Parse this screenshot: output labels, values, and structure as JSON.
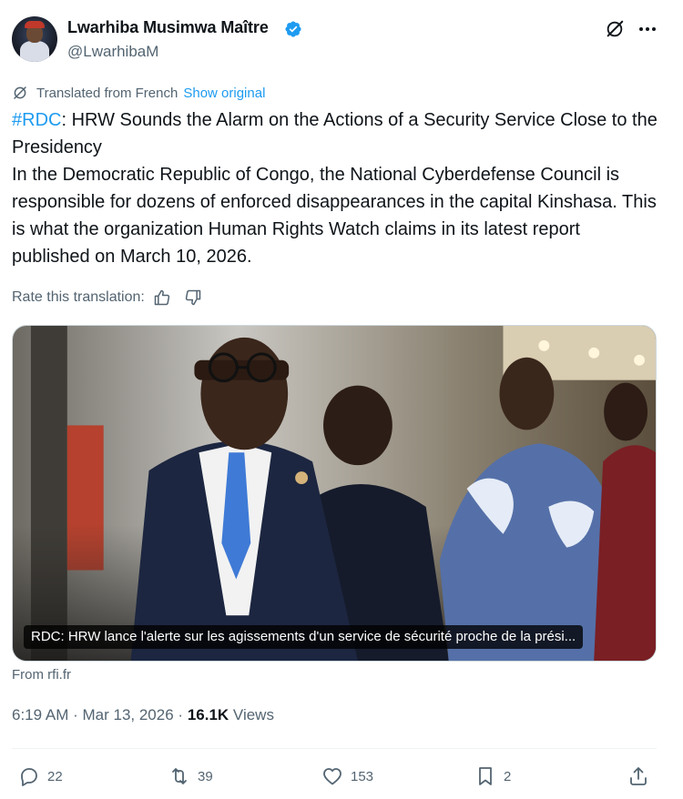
{
  "author": {
    "display_name": "Lwarhiba Musimwa Maître",
    "handle": "@LwarhibaM",
    "verified": true
  },
  "translation": {
    "label": "Translated from French",
    "show_original": "Show original"
  },
  "tweet": {
    "hashtag": "#RDC",
    "text": ": HRW Sounds the Alarm on the Actions of a Security Service Close to the Presidency\nIn the Democratic Republic of Congo, the National Cyberdefense Council is responsible for dozens of enforced disappearances in the capital Kinshasa. This is what the organization Human Rights Watch claims in its latest report published on March 10, 2026."
  },
  "rate": {
    "label": "Rate this translation:"
  },
  "link_card": {
    "caption": "RDC: HRW lance l'alerte sur les agissements d'un service de sécurité proche de la prési...",
    "source": "From rfi.fr"
  },
  "meta": {
    "time": "6:19 AM",
    "date": "Mar 13, 2026",
    "views_count": "16.1K",
    "views_label": "Views"
  },
  "actions": {
    "replies": "22",
    "reposts": "39",
    "likes": "153",
    "bookmarks": "2"
  },
  "colors": {
    "accent": "#1d9bf0",
    "text": "#0f1419",
    "secondary": "#536471"
  }
}
